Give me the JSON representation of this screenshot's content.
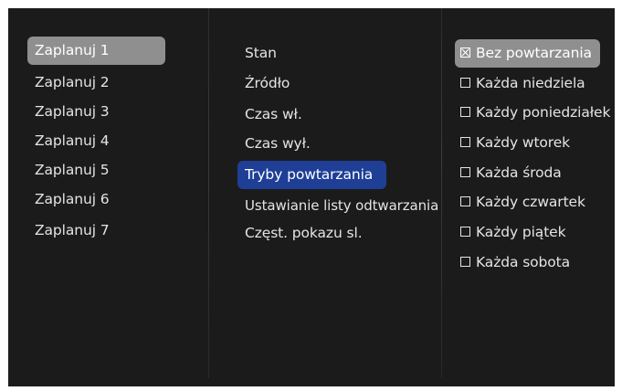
{
  "schedules": [
    "Zaplanuj 1",
    "Zaplanuj 2",
    "Zaplanuj 3",
    "Zaplanuj 4",
    "Zaplanuj 5",
    "Zaplanuj 6",
    "Zaplanuj 7"
  ],
  "settings": [
    "Stan",
    "Źródło",
    "Czas wł.",
    "Czas wył.",
    "Tryby powtarzania",
    "Ustawianie listy odtwarzania",
    "Częst. pokazu sl."
  ],
  "repeat_options": [
    {
      "label": "Bez powtarzania",
      "checked": true
    },
    {
      "label": "Każda niedziela",
      "checked": false
    },
    {
      "label": "Każdy poniedziałek",
      "checked": false
    },
    {
      "label": "Każdy wtorek",
      "checked": false
    },
    {
      "label": "Każda środa",
      "checked": false
    },
    {
      "label": "Każdy czwartek",
      "checked": false
    },
    {
      "label": "Każdy piątek",
      "checked": false
    },
    {
      "label": "Każda sobota",
      "checked": false
    }
  ],
  "colors": {
    "osd_background": "#1b1b1b",
    "selection_grey": "#8f8f8f",
    "selection_blue": "#1f3f96",
    "text": "#e4e4e4"
  }
}
